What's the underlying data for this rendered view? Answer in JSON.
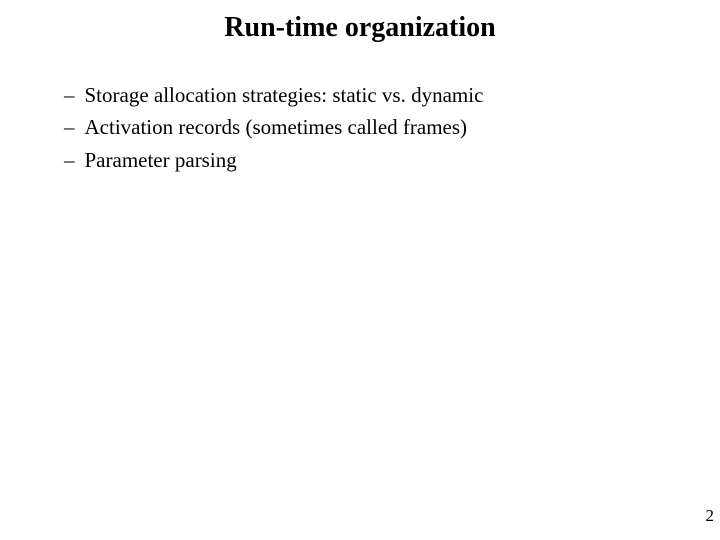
{
  "title": "Run-time organization",
  "bullets": [
    "Storage allocation strategies: static vs. dynamic",
    "Activation records (sometimes called frames)",
    "Parameter parsing"
  ],
  "dash": "–",
  "page_number": "2"
}
